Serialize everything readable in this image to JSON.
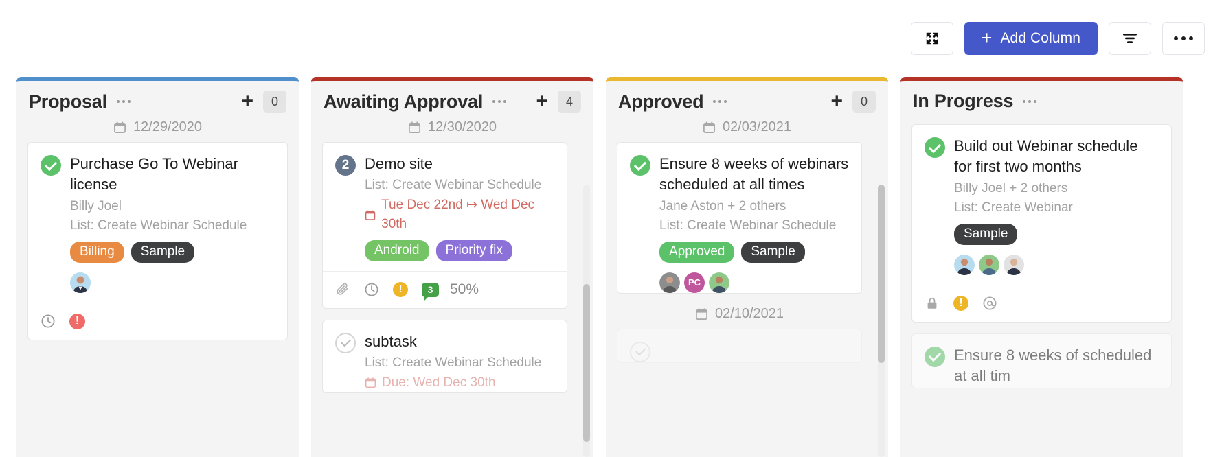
{
  "toolbar": {
    "expand_label": "expand",
    "add_column_label": "Add Column",
    "add_column_plus": "+",
    "filter_label": "filter",
    "more_label": "more"
  },
  "accent_colors": {
    "primary_button": "#4458c9",
    "proposal": "#4e8fcc",
    "awaiting": "#b53227",
    "approved": "#eab830",
    "in_progress": "#b53227",
    "done_green": "#5cc26a",
    "due_red": "#d06a62",
    "tag_billing": "#e98a42",
    "tag_sample": "#3e3f41",
    "tag_android": "#74c365",
    "tag_priority_fix": "#8c71d8",
    "tag_approved": "#5cc26a"
  },
  "columns": [
    {
      "id": "proposal",
      "title": "Proposal",
      "plus": "+",
      "count": "0",
      "date": "12/29/2020",
      "has_scrollbar": false,
      "cards": [
        {
          "check": "done",
          "check_label": "",
          "title": "Purchase Go To Webinar license",
          "assignee": "Billy Joel",
          "list": "List: Create Webinar Schedule",
          "due": "",
          "tags": [
            {
              "label": "Billing",
              "color": "#e98a42"
            },
            {
              "label": "Sample",
              "color": "#3e3f41"
            }
          ],
          "avatars": [
            {
              "initials": "",
              "color": "#b7dcf0"
            }
          ],
          "footer": {
            "icons": [
              "clock-icon",
              "alert-icon"
            ],
            "percent": ""
          }
        }
      ]
    },
    {
      "id": "awaiting",
      "title": "Awaiting Approval",
      "plus": "+",
      "count": "4",
      "date": "12/30/2020",
      "has_scrollbar": true,
      "cards": [
        {
          "check": "num",
          "check_label": "2",
          "title": "Demo site",
          "assignee": "",
          "list": "List: Create Webinar Schedule",
          "due": "Tue Dec 22nd ↦ Wed Dec 30th",
          "tags": [
            {
              "label": "Android",
              "color": "#74c365"
            },
            {
              "label": "Priority fix",
              "color": "#8c71d8"
            }
          ],
          "avatars": [],
          "footer": {
            "icons": [
              "paperclip-icon",
              "clock-icon",
              "warning-icon",
              "comment-badge"
            ],
            "comment_count": "3",
            "percent": "50%"
          }
        },
        {
          "check": "open",
          "check_label": "",
          "title": "subtask",
          "assignee": "",
          "list": "List: Create Webinar Schedule",
          "due": "Due: Wed Dec 30th",
          "tags": [],
          "avatars": [],
          "footer": {
            "icons": [],
            "percent": ""
          }
        }
      ]
    },
    {
      "id": "approved",
      "title": "Approved",
      "plus": "+",
      "count": "0",
      "date": "02/03/2021",
      "date2": "02/10/2021",
      "has_scrollbar": true,
      "cards": [
        {
          "check": "done",
          "check_label": "",
          "title": "Ensure 8 weeks of webinars scheduled at all times",
          "assignee": "Jane Aston + 2 others",
          "list": "List: Create Webinar Schedule",
          "due": "",
          "tags": [
            {
              "label": "Approved",
              "color": "#5cc26a"
            },
            {
              "label": "Sample",
              "color": "#3e3f41"
            }
          ],
          "avatars": [
            {
              "initials": "",
              "color": "#6b6b6b"
            },
            {
              "initials": "PC",
              "color": "#c0569b"
            },
            {
              "initials": "",
              "color": "#8fc98a"
            }
          ],
          "footer": {
            "icons": [],
            "percent": ""
          }
        }
      ]
    },
    {
      "id": "progress",
      "title": "In Progress",
      "plus": "",
      "count": "",
      "date": "",
      "has_scrollbar": false,
      "cards": [
        {
          "check": "done",
          "check_label": "",
          "title": "Build out Webinar schedule for first two months",
          "assignee": "Billy Joel + 2 others",
          "list": "List: Create Webinar",
          "due": "",
          "tags": [
            {
              "label": "Sample",
              "color": "#3e3f41"
            }
          ],
          "avatars": [
            {
              "initials": "",
              "color": "#b7dcf0"
            },
            {
              "initials": "",
              "color": "#8fc98a"
            },
            {
              "initials": "",
              "color": "#d8d8d8"
            }
          ],
          "footer": {
            "icons": [
              "lock-icon",
              "warning-icon",
              "mention-icon"
            ],
            "percent": ""
          }
        },
        {
          "check": "done",
          "check_label": "",
          "title": "Ensure 8 weeks of scheduled at all tim",
          "assignee": "",
          "list": "",
          "due": "",
          "tags": [],
          "avatars": [],
          "footer": {
            "icons": [],
            "percent": ""
          }
        }
      ]
    }
  ]
}
